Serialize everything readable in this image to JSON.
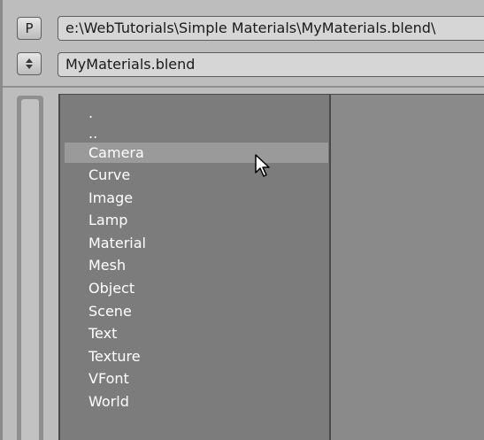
{
  "toolbar": {
    "parent_button_label": "P",
    "path_value": "e:\\WebTutorials\\Simple Materials\\MyMaterials.blend\\",
    "file_value": "MyMaterials.blend"
  },
  "icons": {
    "updown": "updown-arrows-icon",
    "cursor": "mouse-pointer-icon"
  },
  "list": {
    "items": [
      ".",
      "..",
      "Camera",
      "Curve",
      "Image",
      "Lamp",
      "Material",
      "Mesh",
      "Object",
      "Scene",
      "Text",
      "Texture",
      "VFont",
      "World"
    ],
    "highlighted": "Camera"
  },
  "colors": {
    "background": "#bdbdbd",
    "list_bg": "#7c7c7c",
    "highlight": "#9a9a9a",
    "text": "#ffffff"
  }
}
